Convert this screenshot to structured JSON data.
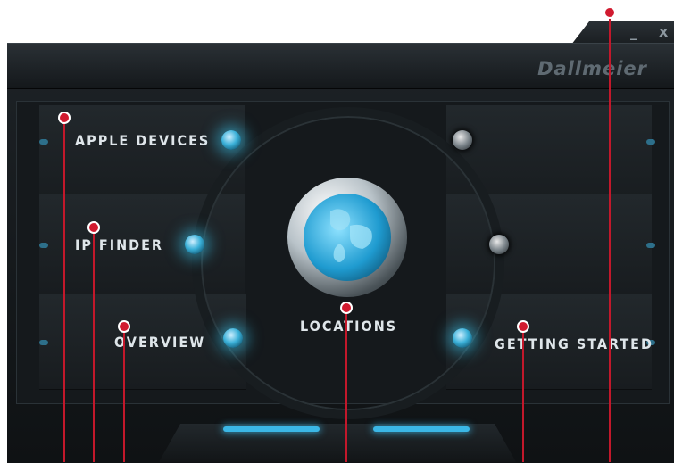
{
  "window": {
    "brand": "Dallmeier",
    "minimize_label": "_",
    "close_label": "x"
  },
  "menu": {
    "apple_devices": "APPLE DEVICES",
    "ip_finder": "IP FINDER",
    "overview": "OVERVIEW",
    "locations": "LOCATIONS",
    "getting_started": "GETTING STARTED"
  },
  "colors": {
    "accent": "#3bb7e6",
    "marker": "#d11a2f"
  }
}
